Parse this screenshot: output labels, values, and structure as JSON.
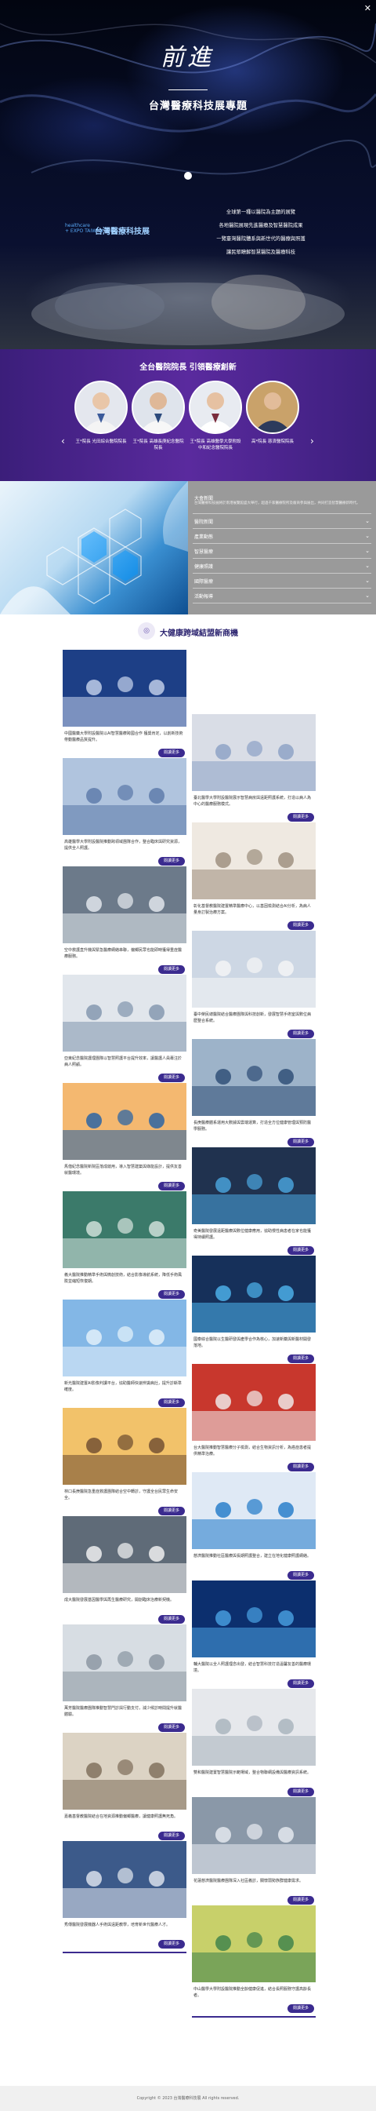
{
  "hero": {
    "close_label": "✕",
    "title_big": "前進",
    "title_sub": "台灣醫療科技展專題",
    "logo_small_1": "healthcare",
    "logo_small_2": "+ EXPO TAIWAN",
    "logo_name": "台灣醫療科技展",
    "lines": [
      "全球第一種以醫院為主題的展覽",
      "各地醫院展現先進醫療及智慧醫院成果",
      "一覽臺灣醫院體系與新世代的醫療與照護",
      "讓民眾瞭解智慧醫院及醫療科技"
    ]
  },
  "directors": {
    "title": "全台醫院院長 引領醫療創新",
    "prev": "‹",
    "next": "›",
    "items": [
      {
        "caption": "王*院長 光田綜合醫院院長"
      },
      {
        "caption": "王*院長 高雄長庚紀念醫院院長"
      },
      {
        "caption": "王*院長 高雄醫學大學附設中和紀念醫院院長"
      },
      {
        "caption": "高*院長 慈濟醫院院長"
      }
    ]
  },
  "accordion": {
    "items": [
      {
        "label": "大會新聞",
        "sub": "台灣醫療科技展將於南港展覽館盛大舉行，超過千家醫療院所及廠商參與展出，共同打造智慧醫療新時代。"
      },
      {
        "label": "醫院新聞"
      },
      {
        "label": "產業動態"
      },
      {
        "label": "智慧醫療"
      },
      {
        "label": "健康照護"
      },
      {
        "label": "國際醫療"
      },
      {
        "label": "活動報導"
      }
    ]
  },
  "section": {
    "icon": "◎",
    "title": "大健康跨域結盟新商機"
  },
  "cards": [
    {
      "text": "中國醫藥大學附設醫院以AI智慧醫療跨國合作 獲獎肯定，以創新技術帶動醫療品質提升。",
      "btn": "閱讀更多"
    },
    {
      "text": "臺北醫學大學附設醫院展示智慧病房與遠距照護系統，打造以病人為中心的醫療服務模式。",
      "btn": "閱讀更多"
    },
    {
      "text": "高雄醫學大學附設醫院推動跨領域團隊合作，整合臨床與研究資源，提供全人照護。",
      "btn": "閱讀更多"
    },
    {
      "text": "彰化基督教醫院建置精準醫療中心，以基因檢測結合AI分析，為病人量身訂製治療方案。",
      "btn": "閱讀更多"
    },
    {
      "text": "空中救護直升機與緊急醫療網絡串聯，偏鄉民眾也能即時獲得重症醫療服務。",
      "btn": "閱讀更多"
    },
    {
      "text": "臺中榮民總醫院結合醫療團隊與科技創新，發展智慧手術室與數位病歷整合系統。",
      "btn": "閱讀更多"
    },
    {
      "text": "亞東紀念醫院護理團隊以智慧照護平台提升效率，讓醫護人員專注於病人照顧。",
      "btn": "閱讀更多"
    },
    {
      "text": "長庚醫療體系運用大數據與雲端運算，打造全方位健康管理與預防醫學服務。",
      "btn": "閱讀更多"
    },
    {
      "text": "馬偕紀念醫院新院區落成啟用，導入智慧建築與綠能設計，提供友善就醫環境。",
      "btn": "閱讀更多"
    },
    {
      "text": "奇美醫院發展遠距醫療與數位健康應用，協助慢性病患者在家也能獲得持續照護。",
      "btn": "閱讀更多"
    },
    {
      "text": "義大醫院推動精準手術與微創技術，結合影像導航系統，降低手術風險並縮短恢復期。",
      "btn": "閱讀更多"
    },
    {
      "text": "國泰綜合醫院以生醫研發與產學合作為核心，加速新藥與新醫材開發落地。",
      "btn": "閱讀更多"
    },
    {
      "text": "新光醫院建置AI影像判讀平台，協助醫師快速辨識病灶，提升診斷準確度。",
      "btn": "閱讀更多"
    },
    {
      "text": "台大醫院推動智慧醫療分子檢測，結合生物資訊分析，為癌症患者提供精準治療。",
      "btn": "閱讀更多"
    },
    {
      "text": "林口長庚醫院急重症救護團隊結合空中轉診，守護全台民眾生命安全。",
      "btn": "閱讀更多"
    },
    {
      "text": "慈濟醫院推動社區醫療與長期照護整合，建立在地化健康照護網絡。",
      "btn": "閱讀更多"
    },
    {
      "text": "成大醫院發展基因醫學與再生醫療研究，開創臨床治療新契機。",
      "btn": "閱讀更多"
    },
    {
      "text": "輔大醫院以全人照護理念出發，結合智慧科技打造溫馨友善的醫療環境。",
      "btn": "閱讀更多"
    },
    {
      "text": "萬芳醫院醫療團隊推動智慧門診與行動支付，減少候診時間提升就醫體驗。",
      "btn": "閱讀更多"
    },
    {
      "text": "雙和醫院建置智慧醫院示範場域，整合物聯網設備與醫療資訊系統。",
      "btn": "閱讀更多"
    },
    {
      "text": "嘉義基督教醫院結合在地資源推動偏鄉醫療，讓健康照護無死角。",
      "btn": "閱讀更多"
    },
    {
      "text": "花蓮慈濟醫院醫療團隊深入社區義診，關懷弱勢族群健康需求。",
      "btn": "閱讀更多"
    },
    {
      "text": "秀傳醫院發展機器人手術與遠距教學，培育新世代醫療人才。",
      "btn": "閱讀更多"
    },
    {
      "text": "中山醫學大學附設醫院推動全齡健康促進，結合長照服務守護高齡長者。",
      "btn": "閱讀更多"
    }
  ],
  "footer": {
    "text": "Copyright © 2023 台灣醫療科技展 All rights reserved."
  }
}
